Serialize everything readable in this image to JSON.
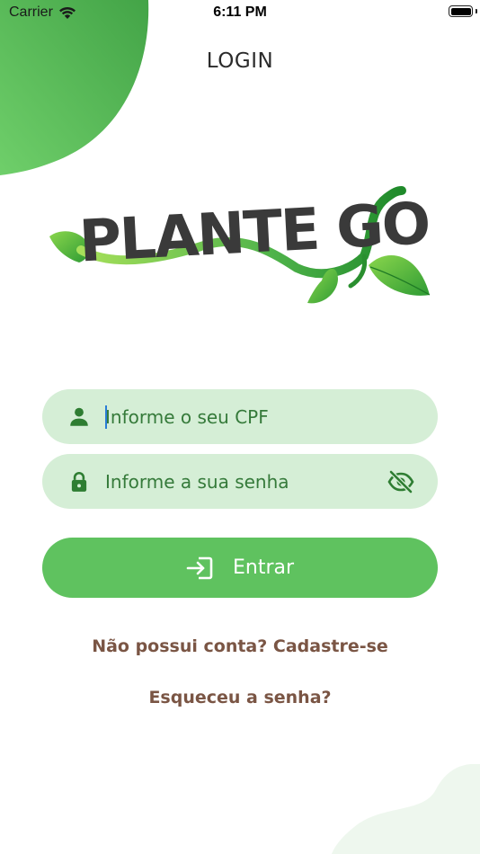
{
  "status_bar": {
    "carrier": "Carrier",
    "time": "6:11 PM"
  },
  "page": {
    "title": "LOGIN"
  },
  "logo": {
    "text": "PLANTE GO"
  },
  "form": {
    "cpf_placeholder": "Informe o seu CPF",
    "password_placeholder": "Informe a sua senha"
  },
  "actions": {
    "login_label": "Entrar",
    "signup_link": "Não possui conta? Cadastre-se",
    "forgot_link": "Esqueceu a senha?"
  },
  "colors": {
    "primary": "#5fc25f",
    "field_bg": "#d5eed6",
    "field_text": "#357a3a",
    "link_text": "#7a5544",
    "icon": "#2e7d32"
  },
  "icons": {
    "user": "person-icon",
    "lock": "lock-icon",
    "visibility": "eye-off-icon",
    "login": "login-arrow-icon",
    "wifi": "wifi-icon",
    "battery": "battery-icon"
  }
}
